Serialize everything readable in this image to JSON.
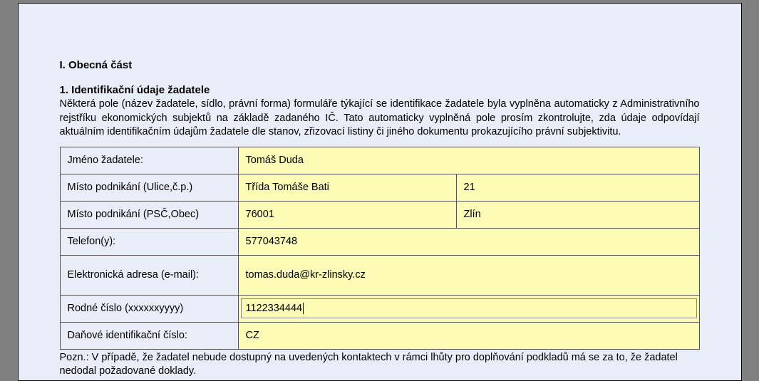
{
  "section_title": "I. Obecná část",
  "subsection_title": "1. Identifikační údaje žadatele",
  "paragraph": "Některá pole (název žadatele, sídlo, právní forma) formuláře týkající se identifikace žadatele byla vyplněna automaticky z Administrativního rejstříku ekonomických subjektů na základě zadaného IČ. Tato automaticky vyplněná pole prosím zkontrolujte, zda údaje odpovídají aktuálním identifikačním údajům žadatele dle stanov, zřizovací listiny či jiného dokumentu prokazujícího právní subjektivitu.",
  "rows": {
    "name": {
      "label": "Jméno žadatele:",
      "value": "Tomáš Duda"
    },
    "street": {
      "label": "Místo podnikání (Ulice,č.p.)",
      "value1": "Třída Tomáše Bati",
      "value2": "21"
    },
    "city": {
      "label": "Místo podnikání (PSČ,Obec)",
      "value1": "76001",
      "value2": "Zlín"
    },
    "phone": {
      "label": "Telefon(y):",
      "value": "577043748"
    },
    "email": {
      "label": "Elektronická adresa (e-mail):",
      "value": "tomas.duda@kr-zlinsky.cz"
    },
    "birthno": {
      "label": "Rodné číslo (xxxxxxyyyy)",
      "value": "1122334444"
    },
    "taxid": {
      "label": "Daňové identifikační číslo:",
      "value": "CZ"
    }
  },
  "note": "Pozn.: V případě, že žadatel nebude dostupný na uvedených kontaktech v rámci lhůty pro doplňování podkladů má se za to, že žadatel nedodal požadované doklady."
}
